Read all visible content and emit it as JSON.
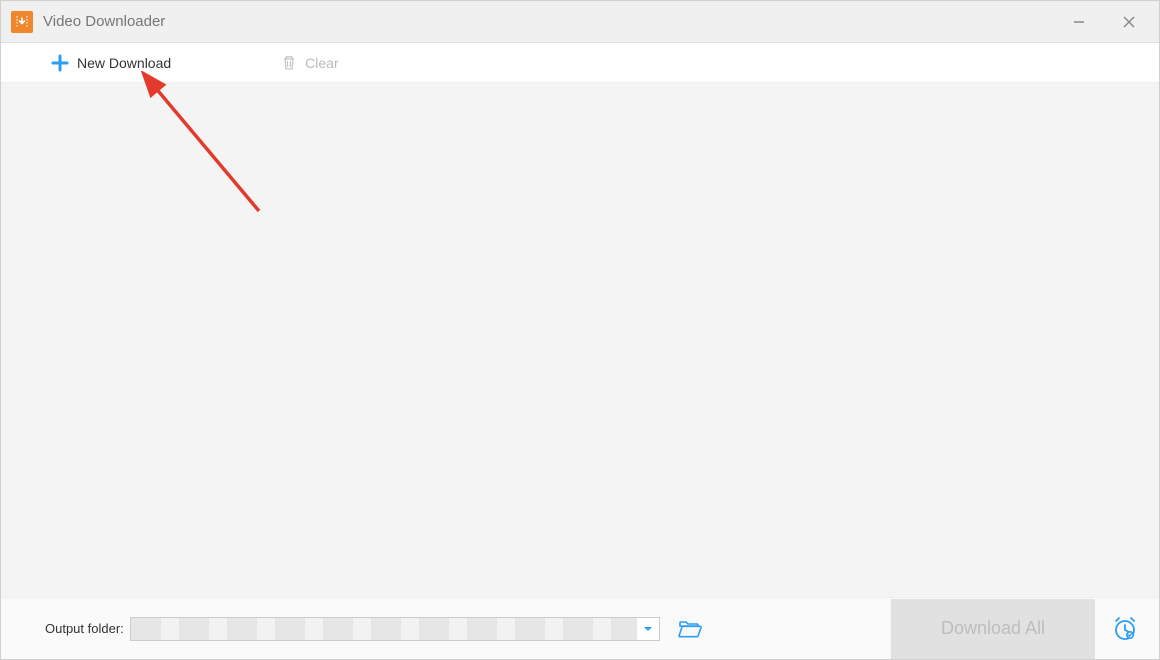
{
  "titlebar": {
    "title": "Video Downloader"
  },
  "toolbar": {
    "new_download_label": "New Download",
    "clear_label": "Clear"
  },
  "footer": {
    "output_folder_label": "Output folder:",
    "output_folder_value": "",
    "download_all_label": "Download All"
  },
  "colors": {
    "accent_blue": "#2a9df5",
    "brand_orange": "#f0872c",
    "arrow_red": "#e23b2e"
  }
}
